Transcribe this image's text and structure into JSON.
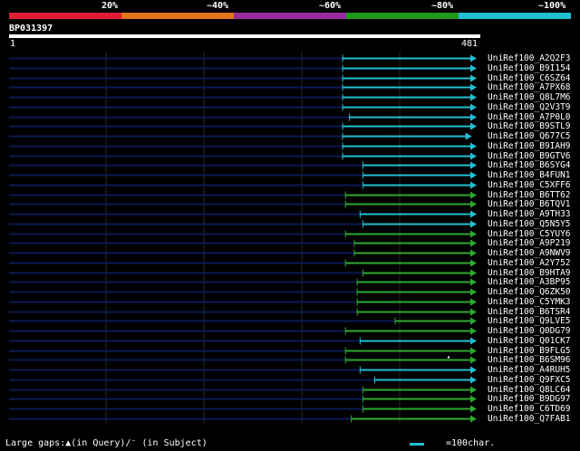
{
  "colors": {
    "background": "#000000",
    "scale": [
      "#e11d36",
      "#e0761a",
      "#9a2b9f",
      "#1f9a1f",
      "#1fbfcf"
    ],
    "line_cyan": "#21c1d2",
    "line_green": "#2ea82e",
    "line_navy": "#0b1a55",
    "grid": "#2a2a2a"
  },
  "legend": {
    "labels": [
      "20%",
      "~40%",
      "~60%",
      "~80%",
      "~100%"
    ]
  },
  "query": {
    "id": "BP031397",
    "start_label": "1",
    "end_label": "481",
    "length": 481
  },
  "footer": {
    "gaps_text": "Large gaps:▲(in Query)/⁻ (in Subject)",
    "scale_text": "=100char."
  },
  "chart_data": {
    "type": "alignment",
    "query_length": 481,
    "hits": [
      {
        "label": "UniRef100_A2Q2F3",
        "start": 344,
        "end": 481,
        "identity": "~100%"
      },
      {
        "label": "UniRef100_B9I154",
        "start": 344,
        "end": 481,
        "identity": "~100%"
      },
      {
        "label": "UniRef100_C6SZ64",
        "start": 344,
        "end": 481,
        "identity": "~100%"
      },
      {
        "label": "UniRef100_A7PX68",
        "start": 344,
        "end": 481,
        "identity": "~100%"
      },
      {
        "label": "UniRef100_Q8L7M6",
        "start": 344,
        "end": 481,
        "identity": "~100%"
      },
      {
        "label": "UniRef100_Q2V3T9",
        "start": 344,
        "end": 481,
        "identity": "~100%"
      },
      {
        "label": "UniRef100_A7P0L0",
        "start": 351,
        "end": 481,
        "identity": "~100%"
      },
      {
        "label": "UniRef100_B9STL9",
        "start": 344,
        "end": 481,
        "identity": "~100%"
      },
      {
        "label": "UniRef100_Q677C5",
        "start": 344,
        "end": 476,
        "identity": "~100%"
      },
      {
        "label": "UniRef100_B9IAH9",
        "start": 344,
        "end": 481,
        "identity": "~100%"
      },
      {
        "label": "UniRef100_B9GTV6",
        "start": 344,
        "end": 481,
        "identity": "~100%"
      },
      {
        "label": "UniRef100_B6SYG4",
        "start": 365,
        "end": 481,
        "identity": "~100%"
      },
      {
        "label": "UniRef100_B4FUN1",
        "start": 365,
        "end": 481,
        "identity": "~100%"
      },
      {
        "label": "UniRef100_C5XFF6",
        "start": 365,
        "end": 481,
        "identity": "~100%"
      },
      {
        "label": "UniRef100_B6TT62",
        "start": 347,
        "end": 481,
        "identity": "~80%"
      },
      {
        "label": "UniRef100_B6TQV1",
        "start": 347,
        "end": 481,
        "identity": "~80%"
      },
      {
        "label": "UniRef100_A9TH33",
        "start": 362,
        "end": 481,
        "identity": "~100%"
      },
      {
        "label": "UniRef100_Q5N5Y5",
        "start": 365,
        "end": 481,
        "identity": "~100%"
      },
      {
        "label": "UniRef100_C5YUY6",
        "start": 347,
        "end": 481,
        "identity": "~80%"
      },
      {
        "label": "UniRef100_A9P219",
        "start": 356,
        "end": 481,
        "identity": "~80%"
      },
      {
        "label": "UniRef100_A9NWV9",
        "start": 356,
        "end": 481,
        "identity": "~80%"
      },
      {
        "label": "UniRef100_A2Y752",
        "start": 347,
        "end": 481,
        "identity": "~80%"
      },
      {
        "label": "UniRef100_B9HTA9",
        "start": 365,
        "end": 481,
        "identity": "~80%"
      },
      {
        "label": "UniRef100_A3BP95",
        "start": 359,
        "end": 481,
        "identity": "~80%"
      },
      {
        "label": "UniRef100_Q6ZK50",
        "start": 359,
        "end": 481,
        "identity": "~80%"
      },
      {
        "label": "UniRef100_C5YMK3",
        "start": 359,
        "end": 481,
        "identity": "~80%"
      },
      {
        "label": "UniRef100_B6TSR4",
        "start": 359,
        "end": 481,
        "identity": "~80%"
      },
      {
        "label": "UniRef100_Q9LVE5",
        "start": 398,
        "end": 481,
        "identity": "~80%"
      },
      {
        "label": "UniRef100_Q0DG79",
        "start": 347,
        "end": 481,
        "identity": "~80%"
      },
      {
        "label": "UniRef100_Q01CK7",
        "start": 362,
        "end": 481,
        "identity": "~100%"
      },
      {
        "label": "UniRef100_B9FLG5",
        "start": 347,
        "end": 481,
        "identity": "~80%"
      },
      {
        "label": "UniRef100_B6SM96",
        "start": 347,
        "end": 481,
        "identity": "~80%",
        "gap_at": 453
      },
      {
        "label": "UniRef100_A4RUH5",
        "start": 362,
        "end": 481,
        "identity": "~100%"
      },
      {
        "label": "UniRef100_Q9FXC5",
        "start": 377,
        "end": 481,
        "identity": "~100%"
      },
      {
        "label": "UniRef100_Q8LC64",
        "start": 365,
        "end": 481,
        "identity": "~80%"
      },
      {
        "label": "UniRef100_B9DG97",
        "start": 365,
        "end": 481,
        "identity": "~80%"
      },
      {
        "label": "UniRef100_C6TD69",
        "start": 365,
        "end": 481,
        "identity": "~80%"
      },
      {
        "label": "UniRef100_Q7FAB1",
        "start": 353,
        "end": 481,
        "identity": "~80%"
      }
    ]
  }
}
